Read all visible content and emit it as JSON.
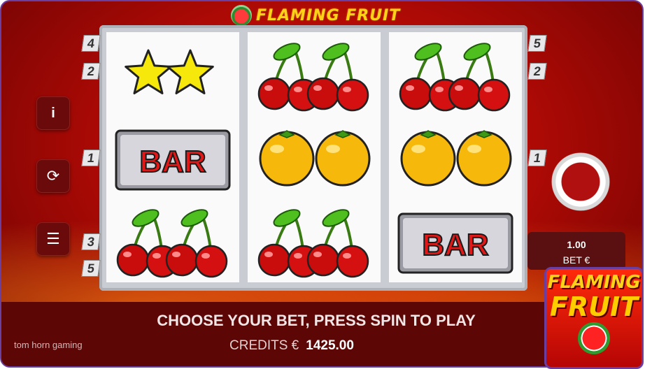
{
  "game": {
    "title": "FLAMING FRUIT",
    "promo_line1": "FLAMING",
    "promo_line2": "FRUIT",
    "developer": "tom horn gaming"
  },
  "reels": [
    [
      "star-icon",
      "bar-symbol",
      "cherry-icon"
    ],
    [
      "cherry-icon",
      "orange-icon",
      "cherry-icon"
    ],
    [
      "cherry-icon",
      "orange-icon",
      "bar-symbol"
    ]
  ],
  "symbols": {
    "bar_label": "BAR"
  },
  "paylines": {
    "left": [
      "4",
      "2",
      "1",
      "3",
      "5"
    ],
    "right": [
      "5",
      "2",
      "1"
    ]
  },
  "controls": {
    "info_label": "i",
    "autoplay_label": "⟳",
    "menu_label": "☰"
  },
  "bet": {
    "value": "1.00",
    "label": "BET €"
  },
  "status": {
    "message": "CHOOSE YOUR BET, PRESS SPIN TO PLAY",
    "credits_label": "CREDITS €",
    "credits_value": "1425.00"
  },
  "colors": {
    "background": "#c0100a",
    "accent": "#ffd21a",
    "bar_red": "#e01818"
  }
}
